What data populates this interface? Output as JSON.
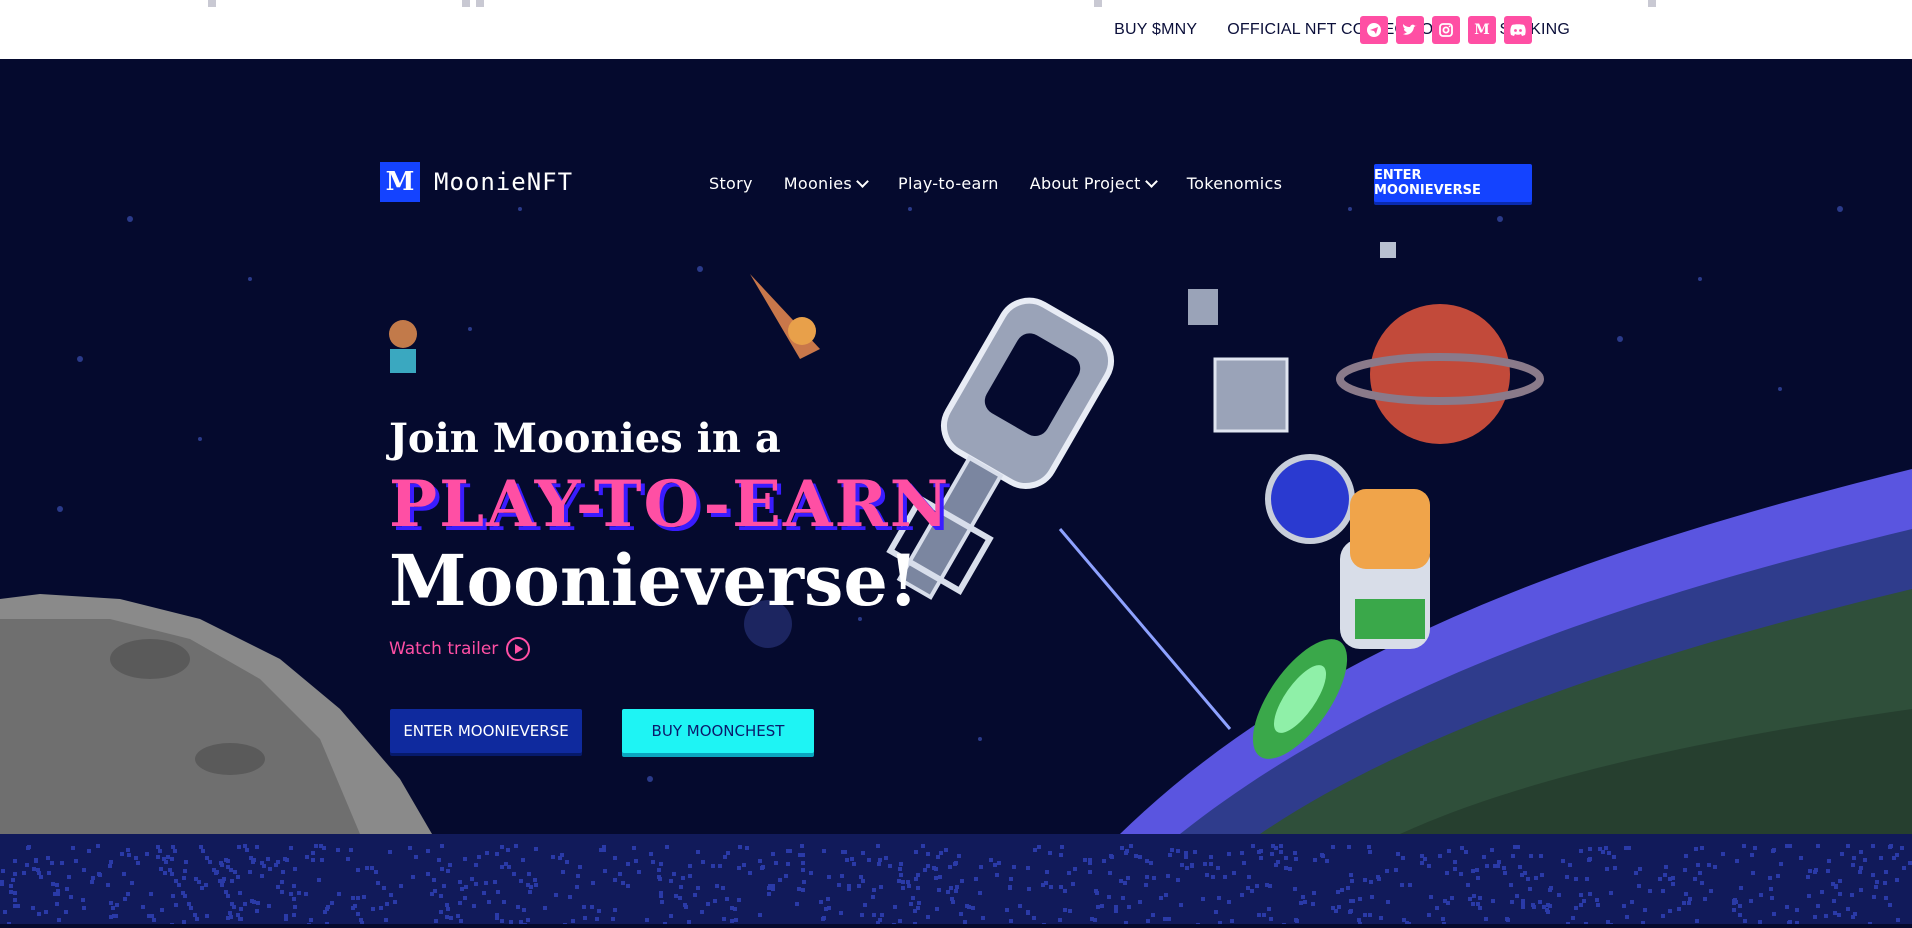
{
  "topbar": {
    "links": [
      "BUY $MNY",
      "OFFICIAL NFT COLLECTION",
      "LP STAKING"
    ],
    "socials": [
      {
        "icon": "telegram-icon",
        "glyph": "➤"
      },
      {
        "icon": "twitter-icon",
        "glyph": "🐦"
      },
      {
        "icon": "instagram-icon",
        "glyph": "◎"
      },
      {
        "icon": "medium-icon",
        "glyph": "M"
      },
      {
        "icon": "discord-icon",
        "glyph": "☺"
      }
    ]
  },
  "nav": {
    "logo_mark": "M",
    "logo_text": "MoonieNFT",
    "items": [
      {
        "label": "Story",
        "dropdown": false
      },
      {
        "label": "Moonies",
        "dropdown": true
      },
      {
        "label": "Play-to-earn",
        "dropdown": false
      },
      {
        "label": "About Project",
        "dropdown": true
      },
      {
        "label": "Tokenomics",
        "dropdown": false
      }
    ],
    "cta": "ENTER MOONIEVERSE"
  },
  "hero": {
    "line1": "Join Moonies in a",
    "line2": "PLAY-TO-EARN",
    "line3": "Moonieverse!",
    "trailer": "Watch trailer",
    "btn_enter": "ENTER MOONIEVERSE",
    "btn_buy": "BUY MOONCHEST"
  },
  "colors": {
    "accent_pink": "#ff4fa4",
    "brand_blue": "#1443ff",
    "cyan": "#1ef4f4",
    "background": "#050a2e"
  }
}
